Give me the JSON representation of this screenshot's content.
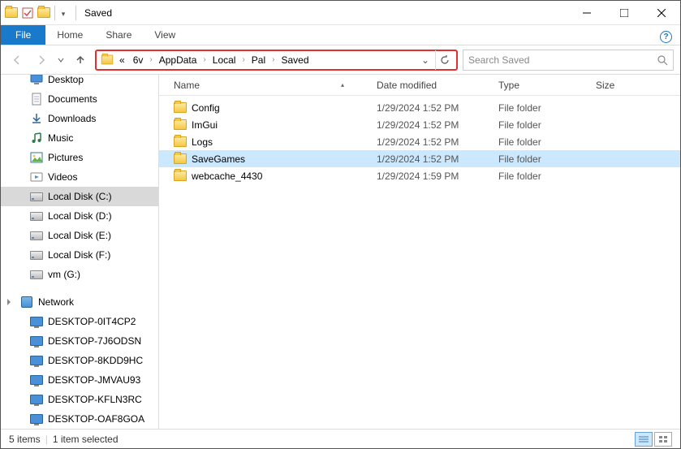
{
  "window": {
    "title": "Saved"
  },
  "tabs": {
    "file": "File",
    "home": "Home",
    "share": "Share",
    "view": "View"
  },
  "breadcrumbs": {
    "prefix": "«",
    "root": "6v",
    "items": [
      "AppData",
      "Local",
      "Pal",
      "Saved"
    ]
  },
  "search": {
    "placeholder": "Search Saved"
  },
  "sidebar": {
    "items": [
      {
        "label": "Desktop",
        "icon": "desktop"
      },
      {
        "label": "Documents",
        "icon": "doc"
      },
      {
        "label": "Downloads",
        "icon": "download"
      },
      {
        "label": "Music",
        "icon": "music"
      },
      {
        "label": "Pictures",
        "icon": "picture"
      },
      {
        "label": "Videos",
        "icon": "video"
      },
      {
        "label": "Local Disk (C:)",
        "icon": "drive",
        "selected": true
      },
      {
        "label": "Local Disk (D:)",
        "icon": "drive"
      },
      {
        "label": "Local Disk (E:)",
        "icon": "drive"
      },
      {
        "label": "Local Disk (F:)",
        "icon": "drive"
      },
      {
        "label": "vm (G:)",
        "icon": "drive"
      }
    ],
    "network": {
      "label": "Network",
      "hosts": [
        "DESKTOP-0IT4CP2",
        "DESKTOP-7J6ODSN",
        "DESKTOP-8KDD9HC",
        "DESKTOP-JMVAU93",
        "DESKTOP-KFLN3RC",
        "DESKTOP-OAF8GOA"
      ]
    }
  },
  "columns": {
    "name": "Name",
    "date": "Date modified",
    "type": "Type",
    "size": "Size"
  },
  "files": [
    {
      "name": "Config",
      "date": "1/29/2024 1:52 PM",
      "type": "File folder"
    },
    {
      "name": "ImGui",
      "date": "1/29/2024 1:52 PM",
      "type": "File folder"
    },
    {
      "name": "Logs",
      "date": "1/29/2024 1:52 PM",
      "type": "File folder"
    },
    {
      "name": "SaveGames",
      "date": "1/29/2024 1:52 PM",
      "type": "File folder",
      "selected": true
    },
    {
      "name": "webcache_4430",
      "date": "1/29/2024 1:59 PM",
      "type": "File folder"
    }
  ],
  "status": {
    "count": "5 items",
    "selection": "1 item selected"
  }
}
